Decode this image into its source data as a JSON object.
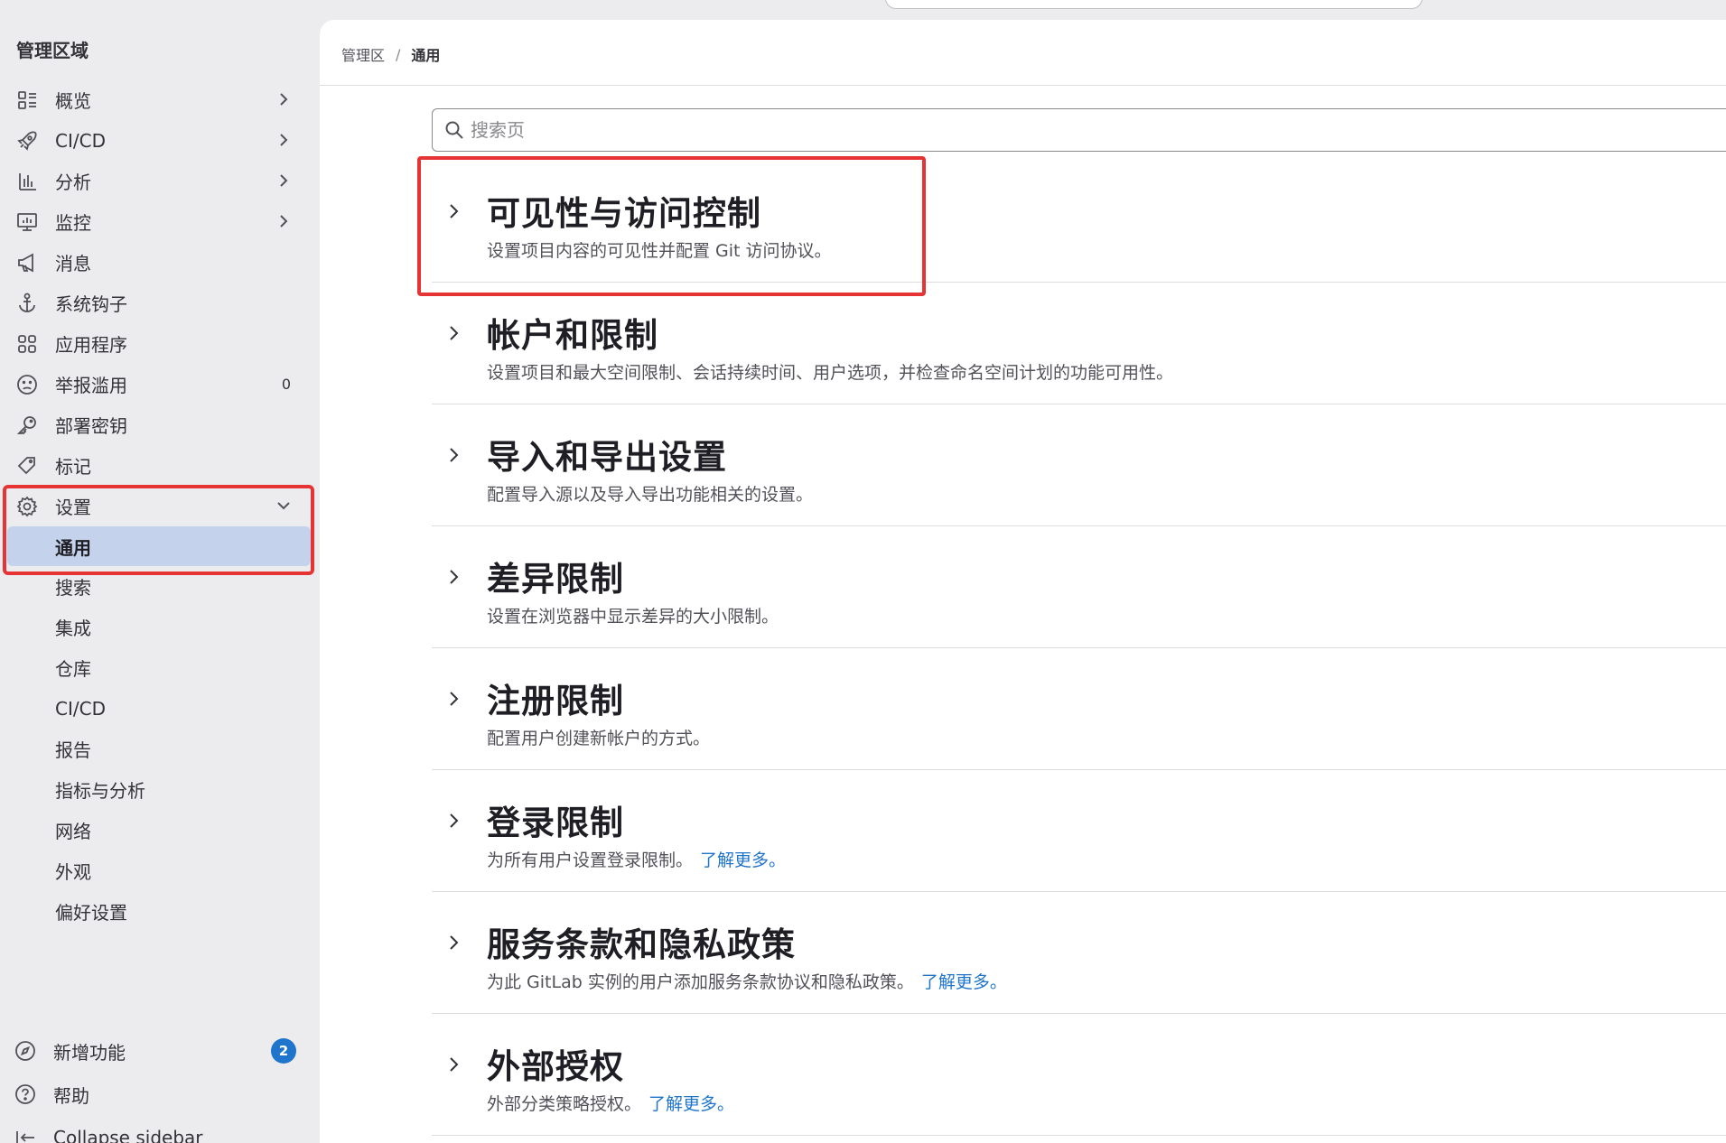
{
  "sidebar": {
    "title": "管理区域",
    "items": [
      {
        "label": "概览"
      },
      {
        "label": "CI/CD"
      },
      {
        "label": "分析"
      },
      {
        "label": "监控"
      },
      {
        "label": "消息"
      },
      {
        "label": "系统钩子"
      },
      {
        "label": "应用程序"
      },
      {
        "label": "举报滥用",
        "count": "0"
      },
      {
        "label": "部署密钥"
      },
      {
        "label": "标记"
      },
      {
        "label": "设置"
      }
    ],
    "settings_sub": [
      {
        "label": "通用"
      },
      {
        "label": "搜索"
      },
      {
        "label": "集成"
      },
      {
        "label": "仓库"
      },
      {
        "label": "CI/CD"
      },
      {
        "label": "报告"
      },
      {
        "label": "指标与分析"
      },
      {
        "label": "网络"
      },
      {
        "label": "外观"
      },
      {
        "label": "偏好设置"
      }
    ],
    "bottom": {
      "whats_new": "新增功能",
      "whats_new_count": "2",
      "help": "帮助",
      "collapse": "Collapse sidebar"
    }
  },
  "breadcrumb": {
    "parent": "管理区",
    "separator": "/",
    "current": "通用"
  },
  "search": {
    "placeholder": "搜索页"
  },
  "sections": [
    {
      "title": "可见性与访问控制",
      "desc": "设置项目内容的可见性并配置 Git 访问协议。",
      "link": ""
    },
    {
      "title": "帐户和限制",
      "desc": "设置项目和最大空间限制、会话持续时间、用户选项，并检查命名空间计划的功能可用性。",
      "link": ""
    },
    {
      "title": "导入和导出设置",
      "desc": "配置导入源以及导入导出功能相关的设置。",
      "link": ""
    },
    {
      "title": "差异限制",
      "desc": "设置在浏览器中显示差异的大小限制。",
      "link": ""
    },
    {
      "title": "注册限制",
      "desc": "配置用户创建新帐户的方式。",
      "link": ""
    },
    {
      "title": "登录限制",
      "desc": "为所有用户设置登录限制。",
      "link": "了解更多。"
    },
    {
      "title": "服务条款和隐私政策",
      "desc": "为此 GitLab 实例的用户添加服务条款协议和隐私政策。",
      "link": "了解更多。"
    },
    {
      "title": "外部授权",
      "desc": "外部分类策略授权。",
      "link": "了解更多。"
    }
  ],
  "colors": {
    "accent": "#1f75cb",
    "highlight": "#e63333",
    "active_bg": "#c4d3eb"
  }
}
